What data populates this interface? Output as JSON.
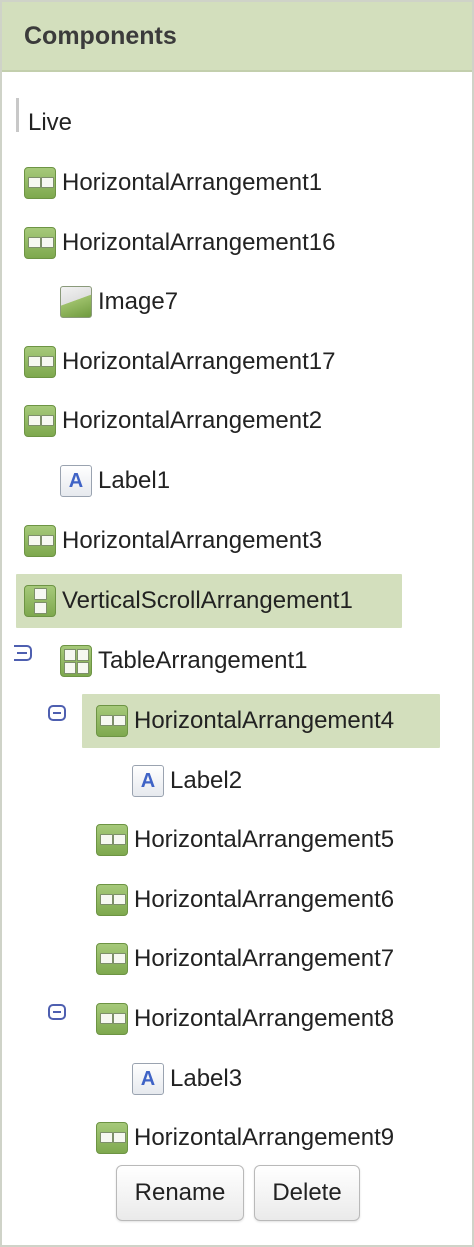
{
  "header": {
    "title": "Components"
  },
  "tree": {
    "live": "Live",
    "items": [
      {
        "label": "HorizontalArrangement1",
        "icon": "horizontal-arrangement-icon"
      },
      {
        "label": "HorizontalArrangement16",
        "icon": "horizontal-arrangement-icon"
      },
      {
        "label": "Image7",
        "icon": "image-icon"
      },
      {
        "label": "HorizontalArrangement17",
        "icon": "horizontal-arrangement-icon"
      },
      {
        "label": "HorizontalArrangement2",
        "icon": "horizontal-arrangement-icon"
      },
      {
        "label": "Label1",
        "icon": "label-icon"
      },
      {
        "label": "HorizontalArrangement3",
        "icon": "horizontal-arrangement-icon"
      },
      {
        "label": "VerticalScrollArrangement1",
        "icon": "vertical-scroll-arrangement-icon"
      },
      {
        "label": "TableArrangement1",
        "icon": "table-arrangement-icon"
      },
      {
        "label": "HorizontalArrangement4",
        "icon": "horizontal-arrangement-icon"
      },
      {
        "label": "Label2",
        "icon": "label-icon"
      },
      {
        "label": "HorizontalArrangement5",
        "icon": "horizontal-arrangement-icon"
      },
      {
        "label": "HorizontalArrangement6",
        "icon": "horizontal-arrangement-icon"
      },
      {
        "label": "HorizontalArrangement7",
        "icon": "horizontal-arrangement-icon"
      },
      {
        "label": "HorizontalArrangement8",
        "icon": "horizontal-arrangement-icon"
      },
      {
        "label": "Label3",
        "icon": "label-icon"
      },
      {
        "label": "HorizontalArrangement9",
        "icon": "horizontal-arrangement-icon"
      }
    ]
  },
  "label_icon_glyph": "A",
  "buttons": {
    "rename": "Rename",
    "delete": "Delete"
  },
  "colors": {
    "header_bg": "#d3dfbd",
    "selection_bg": "#d3dfbd",
    "toggle": "#4e5fb0"
  }
}
